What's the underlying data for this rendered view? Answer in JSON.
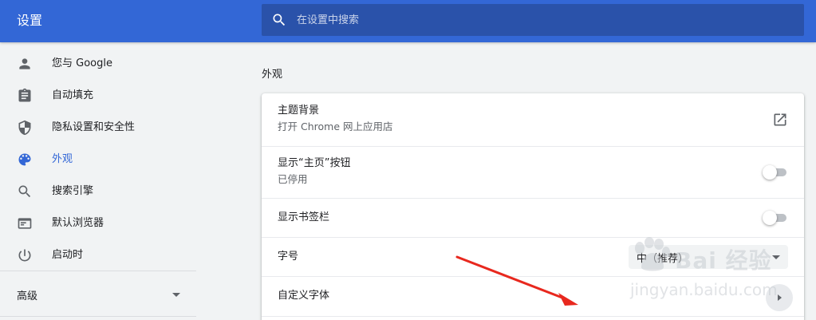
{
  "header": {
    "title": "设置",
    "search_placeholder": "在设置中搜索"
  },
  "sidebar": {
    "items": [
      {
        "label": "您与 Google",
        "icon": "person-icon"
      },
      {
        "label": "自动填充",
        "icon": "clipboard-icon"
      },
      {
        "label": "隐私设置和安全性",
        "icon": "shield-icon"
      },
      {
        "label": "外观",
        "icon": "palette-icon",
        "active": true
      },
      {
        "label": "搜索引擎",
        "icon": "search-icon"
      },
      {
        "label": "默认浏览器",
        "icon": "browser-icon"
      },
      {
        "label": "启动时",
        "icon": "power-icon"
      }
    ],
    "advanced_label": "高级"
  },
  "main": {
    "section_title": "外观",
    "rows": [
      {
        "title": "主题背景",
        "subtitle": "打开 Chrome 网上应用店",
        "control": "external-link"
      },
      {
        "title": "显示“主页”按钮",
        "subtitle": "已停用",
        "control": "toggle",
        "on": false
      },
      {
        "title": "显示书签栏",
        "control": "toggle",
        "on": false
      },
      {
        "title": "字号",
        "control": "select",
        "value": "中（推荐）"
      },
      {
        "title": "自定义字体",
        "control": "subpage-arrow"
      }
    ]
  },
  "watermark": {
    "brand": "Bai 经验",
    "url": "jingyan.baidu.com"
  },
  "colors": {
    "header_bg": "#3367d6",
    "search_bg": "#2a52aa",
    "active": "#3367d6",
    "annotation_arrow": "#e8281e"
  }
}
